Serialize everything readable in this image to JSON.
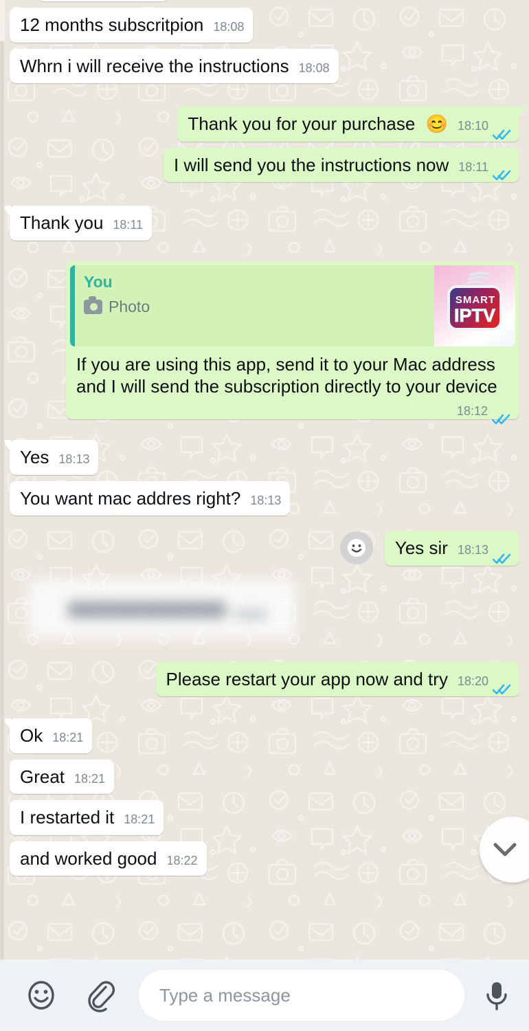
{
  "app": {
    "name": "WhatsApp Chat"
  },
  "wallpaper": {
    "color": "#ebe6de"
  },
  "colors": {
    "incoming_bubble": "#ffffff",
    "outgoing_bubble": "#dcf8c6",
    "quote_accent": "#2fb3a0",
    "tick_blue": "#34b7f1",
    "time_text": "#7d8a91",
    "composer_bg": "#eff2f5"
  },
  "messages": [
    {
      "id": "m1",
      "side": "in",
      "text": "12 months subscritpion",
      "time": "18:08",
      "tail": false,
      "status": null
    },
    {
      "id": "m2",
      "side": "in",
      "text": "Whrn i will receive the instructions",
      "time": "18:08",
      "tail": false,
      "status": null
    },
    {
      "id": "m3",
      "side": "out",
      "text": "Thank you for your purchase",
      "emoji": "😊",
      "time": "18:10",
      "tail": true,
      "status": "read"
    },
    {
      "id": "m4",
      "side": "out",
      "text": "I will send you the instructions now",
      "time": "18:11",
      "tail": false,
      "status": "read"
    },
    {
      "id": "m5",
      "side": "in",
      "text": "Thank you",
      "time": "18:11",
      "tail": true,
      "status": null
    },
    {
      "id": "m6",
      "side": "out",
      "type": "quoted",
      "quote": {
        "author": "You",
        "kind_label": "Photo",
        "kind_icon": "camera-icon",
        "thumbnail_alt": "Smart IPTV app logo",
        "thumbnail": {
          "line1": "Smart",
          "line2": "IPTV"
        }
      },
      "text": "If you are using this app, send it to your Mac address and I will send the subscription directly to your device",
      "time": "18:12",
      "tail": false,
      "status": "read"
    },
    {
      "id": "m7",
      "side": "in",
      "text": "Yes",
      "time": "18:13",
      "tail": true,
      "status": null
    },
    {
      "id": "m8",
      "side": "in",
      "text": "You want mac addres right?",
      "time": "18:13",
      "tail": false,
      "status": null
    },
    {
      "id": "m9",
      "side": "out",
      "text": "Yes sir",
      "time": "18:13",
      "tail": false,
      "status": "read",
      "reaction_icon": "smiley-face-icon"
    },
    {
      "id": "m10",
      "side": "in",
      "type": "redacted",
      "text": "",
      "time": "",
      "status": null
    },
    {
      "id": "m11",
      "side": "out",
      "text": "Please restart your app now and try",
      "time": "18:20",
      "tail": false,
      "status": "read"
    },
    {
      "id": "m12",
      "side": "in",
      "text": "Ok",
      "time": "18:21",
      "tail": true,
      "status": null
    },
    {
      "id": "m13",
      "side": "in",
      "text": "Great",
      "time": "18:21",
      "tail": false,
      "status": null
    },
    {
      "id": "m14",
      "side": "in",
      "text": "I restarted it",
      "time": "18:21",
      "tail": false,
      "status": null
    },
    {
      "id": "m15",
      "side": "in",
      "text": "and worked good",
      "time": "18:22",
      "tail": false,
      "status": null
    }
  ],
  "scroll_button": {
    "icon": "chevron-down-icon"
  },
  "composer": {
    "emoji_icon": "smiley-face-icon",
    "attach_icon": "paperclip-icon",
    "placeholder": "Type a message",
    "value": "",
    "mic_icon": "microphone-icon"
  }
}
